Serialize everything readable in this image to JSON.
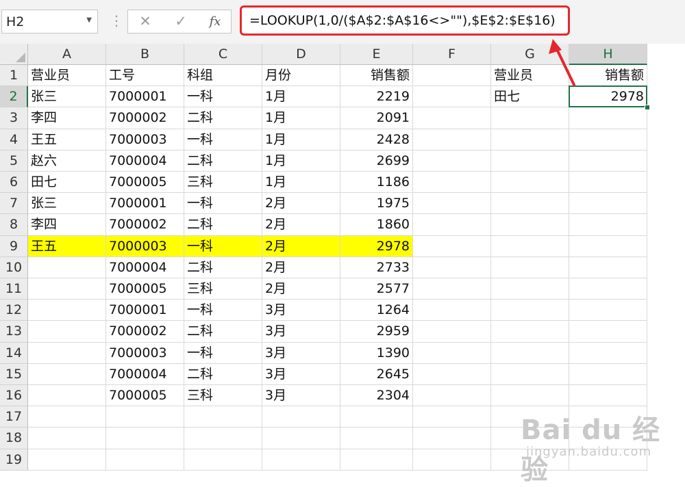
{
  "formula_bar": {
    "name_box": "H2",
    "name_box_dropdown_icon": "chevron-down-icon",
    "cancel_icon": "close-icon",
    "enter_icon": "check-icon",
    "fx_label": "fx",
    "formula": "=LOOKUP(1,0/($A$2:$A$16<>\"\"),$E$2:$E$16)",
    "highlight_color": "#e6262c"
  },
  "sheet": {
    "columns": [
      "A",
      "B",
      "C",
      "D",
      "E",
      "F",
      "G",
      "H"
    ],
    "active_column": "H",
    "row_numbers": [
      "1",
      "2",
      "3",
      "4",
      "5",
      "6",
      "7",
      "8",
      "9",
      "10",
      "11",
      "12",
      "13",
      "14",
      "15",
      "16",
      "17",
      "18",
      "19"
    ],
    "active_row": "2",
    "headers": {
      "salesperson": "营业员",
      "id": "工号",
      "group": "科组",
      "month": "月份",
      "sales": "销售额"
    },
    "rows": [
      {
        "salesperson": "张三",
        "id": "7000001",
        "group": "一科",
        "month": "1月",
        "sales": "2219"
      },
      {
        "salesperson": "李四",
        "id": "7000002",
        "group": "二科",
        "month": "1月",
        "sales": "2091"
      },
      {
        "salesperson": "王五",
        "id": "7000003",
        "group": "一科",
        "month": "1月",
        "sales": "2428"
      },
      {
        "salesperson": "赵六",
        "id": "7000004",
        "group": "二科",
        "month": "1月",
        "sales": "2699"
      },
      {
        "salesperson": "田七",
        "id": "7000005",
        "group": "三科",
        "month": "1月",
        "sales": "1186"
      },
      {
        "salesperson": "张三",
        "id": "7000001",
        "group": "一科",
        "month": "2月",
        "sales": "1975"
      },
      {
        "salesperson": "李四",
        "id": "7000002",
        "group": "二科",
        "month": "2月",
        "sales": "1860"
      },
      {
        "salesperson": "王五",
        "id": "7000003",
        "group": "一科",
        "month": "2月",
        "sales": "2978"
      },
      {
        "salesperson": "",
        "id": "7000004",
        "group": "二科",
        "month": "2月",
        "sales": "2733"
      },
      {
        "salesperson": "",
        "id": "7000005",
        "group": "三科",
        "month": "2月",
        "sales": "2577"
      },
      {
        "salesperson": "",
        "id": "7000001",
        "group": "一科",
        "month": "3月",
        "sales": "1264"
      },
      {
        "salesperson": "",
        "id": "7000002",
        "group": "二科",
        "month": "3月",
        "sales": "2959"
      },
      {
        "salesperson": "",
        "id": "7000003",
        "group": "一科",
        "month": "3月",
        "sales": "1390"
      },
      {
        "salesperson": "",
        "id": "7000004",
        "group": "二科",
        "month": "3月",
        "sales": "2645"
      },
      {
        "salesperson": "",
        "id": "7000005",
        "group": "三科",
        "month": "3月",
        "sales": "2304"
      }
    ],
    "highlight_row": "9",
    "highlight_color": "#ffff00",
    "result": {
      "g1": "营业员",
      "h1": "销售额",
      "g2": "田七",
      "h2": "2978"
    }
  },
  "watermark": {
    "logo": "Bai du 经验",
    "sub": "jingyan.baidu.com"
  }
}
